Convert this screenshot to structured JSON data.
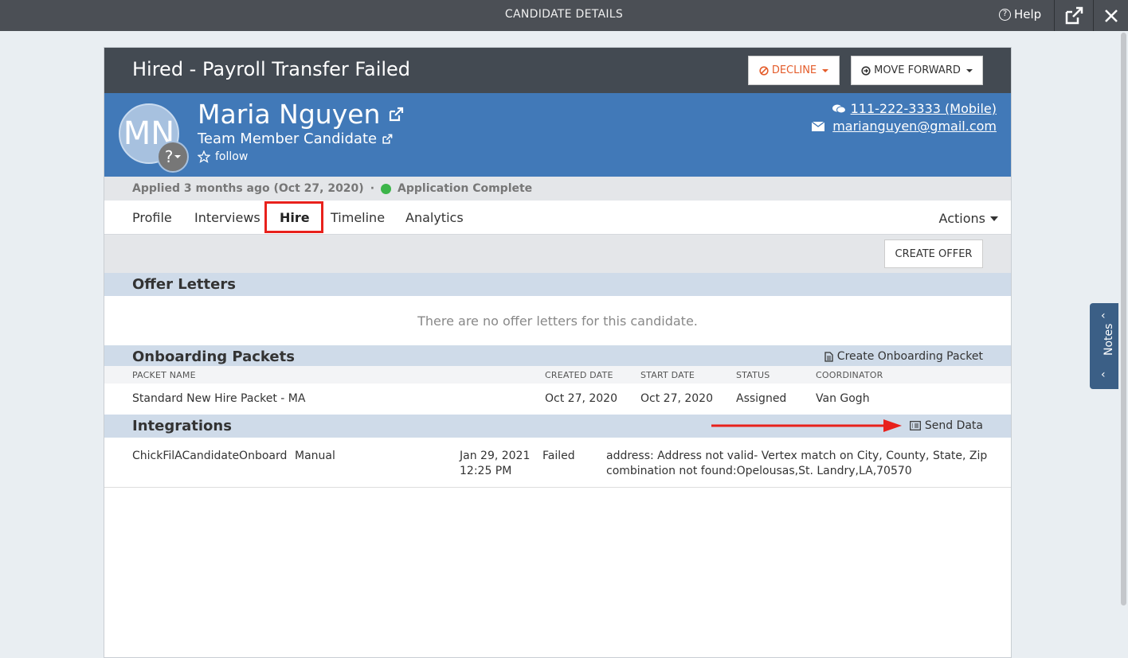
{
  "window": {
    "title": "CANDIDATE DETAILS",
    "help_label": "Help"
  },
  "status": {
    "title": "Hired - Payroll Transfer Failed",
    "decline_label": "DECLINE",
    "move_forward_label": "MOVE FORWARD"
  },
  "candidate": {
    "initials": "MN",
    "badge": "?",
    "name": "Maria Nguyen",
    "role": "Team Member Candidate",
    "follow_label": "follow",
    "phone": "111-222-3333 (Mobile)",
    "email": "marianguyen@gmail.com"
  },
  "applied": {
    "text": "Applied 3 months ago (Oct 27, 2020)",
    "separator": "·",
    "status": "Application Complete"
  },
  "tabs": [
    {
      "label": "Profile"
    },
    {
      "label": "Interviews"
    },
    {
      "label": "Hire"
    },
    {
      "label": "Timeline"
    },
    {
      "label": "Analytics"
    }
  ],
  "actions_label": "Actions",
  "toolbar": {
    "create_offer_label": "CREATE OFFER"
  },
  "offer_letters": {
    "title": "Offer Letters",
    "empty": "There are no offer letters for this candidate."
  },
  "onboarding": {
    "title": "Onboarding Packets",
    "create_link": "Create Onboarding Packet",
    "columns": [
      "PACKET NAME",
      "CREATED DATE",
      "START DATE",
      "STATUS",
      "COORDINATOR"
    ],
    "rows": [
      {
        "name": "Standard New Hire Packet - MA",
        "created": "Oct 27, 2020",
        "start": "Oct 27, 2020",
        "status": "Assigned",
        "coordinator": "Van Gogh"
      }
    ]
  },
  "integrations": {
    "title": "Integrations",
    "send_data_label": "Send Data",
    "rows": [
      {
        "name": "ChickFilACandidateOnboard",
        "mode": "Manual",
        "date": "Jan 29, 2021",
        "time": "12:25 PM",
        "status": "Failed",
        "message_line1": "address: Address not valid- Vertex match on City, County, State, Zip",
        "message_line2": "combination not found:Opelousas,St. Landry,LA,70570"
      }
    ]
  },
  "notes_label": "Notes",
  "colors": {
    "topbar": "#4b4f55",
    "status_bar": "#434a52",
    "header_blue": "#4179b8",
    "section_blue": "#cfdbe9",
    "decline_orange": "#e45c2a",
    "highlight_red": "#e8211c",
    "complete_green": "#3cb54a"
  }
}
